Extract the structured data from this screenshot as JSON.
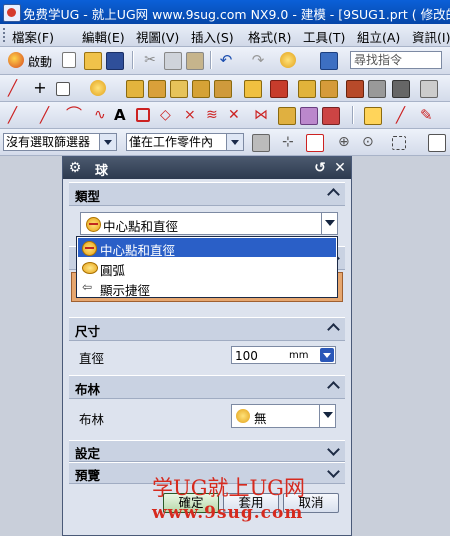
{
  "window": {
    "title": "免费学UG - 就上UG网 www.9sug.com    NX9.0 - 建模 - [9SUG1.prt  ( 修改的 )"
  },
  "menubar": {
    "items": [
      "檔案(F)",
      "編輯(E)",
      "視圖(V)",
      "插入(S)",
      "格式(R)",
      "工具(T)",
      "組立(A)",
      "資訊(I)"
    ]
  },
  "toolbar1": {
    "start_label": "啟動",
    "command_search_placeholder": "尋找指令"
  },
  "selection_bar": {
    "filter_value": "沒有選取篩選器",
    "scope_value": "僅在工作零件內"
  },
  "dialog": {
    "title": "球",
    "sections": {
      "type": {
        "title": "類型",
        "selected": "中心點和直徑",
        "options": [
          "中心點和直徑",
          "圓弧",
          "顯示捷徑"
        ]
      },
      "dimensions": {
        "title": "尺寸",
        "diameter_label": "直徑",
        "diameter_value": "100",
        "diameter_unit": "mm"
      },
      "boolean": {
        "title": "布林",
        "label": "布林",
        "value": "無"
      },
      "settings": {
        "title": "設定"
      },
      "preview": {
        "title": "預覽"
      }
    },
    "buttons": {
      "ok": "確定",
      "apply": "套用",
      "cancel": "取消"
    }
  },
  "watermark": {
    "line1": "学UG就上UG网",
    "line2": "www.9sug.com"
  }
}
